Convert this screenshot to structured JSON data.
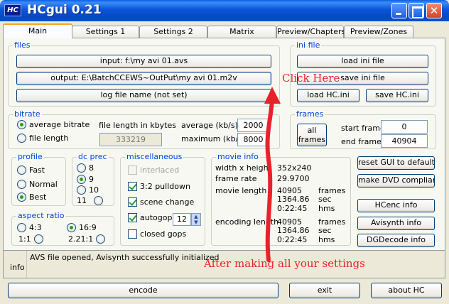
{
  "window": {
    "title": "HCgui 0.21",
    "icon_text": "HC",
    "close_glyph": "✕"
  },
  "tabs": [
    "Main",
    "Settings 1",
    "Settings 2",
    "Matrix",
    "Preview/Chapters",
    "Preview/Zones"
  ],
  "files": {
    "title": "files",
    "input_button": "input: f:\\my avi 01.avs",
    "output_button": "output: E:\\BatchCCEWS~OutPut\\my avi 01.m2v",
    "log_button": "log file name (not set)"
  },
  "ini_file": {
    "title": "ini file",
    "load_ini": "load ini file",
    "save_ini": "save ini file",
    "load_hc": "load HC.ini",
    "save_hc": "save HC.ini"
  },
  "bitrate": {
    "title": "bitrate",
    "average_bitrate": "average bitrate",
    "file_length": "file length",
    "file_length_kb_label": "file length in kbytes",
    "file_length_kb_value": "333219",
    "average_label": "average (kb/s)",
    "average_value": "2000",
    "maximum_label": "maximum (kb/s)",
    "maximum_value": "8000"
  },
  "frames": {
    "title": "frames",
    "all_frames": "all frames",
    "start_label": "start frame",
    "start_value": "0",
    "end_label": "end frame",
    "end_value": "40904"
  },
  "profile": {
    "title": "profile",
    "options": [
      "Fast",
      "Normal",
      "Best"
    ],
    "selected": "Best"
  },
  "dc_prec": {
    "title": "dc prec",
    "options": [
      "8",
      "9",
      "10",
      "11"
    ],
    "selected": "9"
  },
  "aspect_ratio": {
    "title": "aspect ratio",
    "options": [
      "4:3",
      "16:9",
      "1:1",
      "2.21:1"
    ],
    "selected": "16:9"
  },
  "misc": {
    "title": "miscellaneous",
    "interlaced": "interlaced",
    "pulldown": "3:2 pulldown",
    "scene_change": "scene change",
    "autogop": "autogop",
    "autogop_value": "12",
    "closed_gops": "closed gops"
  },
  "movie_info": {
    "title": "movie info",
    "width_height_label": "width x height",
    "width_height_value": "352x240",
    "frame_rate_label": "frame rate",
    "frame_rate_value": "29.9700",
    "movie_length_label": "movie length",
    "movie_length": [
      {
        "value": "40905",
        "unit": "frames"
      },
      {
        "value": "1364.86",
        "unit": "sec"
      },
      {
        "value": "0:22:45",
        "unit": "hms"
      }
    ],
    "encoding_length_label": "encoding length",
    "encoding_length": [
      {
        "value": "40905",
        "unit": "frames"
      },
      {
        "value": "1364.86",
        "unit": "sec"
      },
      {
        "value": "0:22:45",
        "unit": "hms"
      }
    ]
  },
  "side_buttons": [
    "reset GUI to default",
    "make DVD compliant",
    "HCenc info",
    "Avisynth info",
    "DGDecode info"
  ],
  "info": {
    "label": "info",
    "message": "AVS file opened, Avisynth successfully initialized"
  },
  "bottom_buttons": {
    "encode": "encode",
    "exit": "exit",
    "about": "about HC"
  },
  "annotations": {
    "click_here": "Click Here",
    "after_settings": "After making all your settings",
    "color": "#e8222a"
  }
}
